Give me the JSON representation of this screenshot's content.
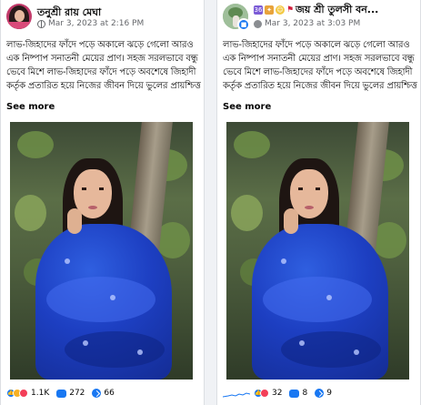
{
  "posts": [
    {
      "author": "তনুশ্রী রায় মেঘা",
      "time": "Mar 3, 2023 at 2:16 PM",
      "body": "লাভ-জিহাদের ফাঁদে পড়ে অকালে ঝড়ে গেলো আরও এক নিষ্পাপ সনাতনী মেয়ের প্রাণ। সহজ সরলভাবে বন্ধু ভেবে মিশে লাভ-জিহাদের ফাঁদে পড়ে অবশেষে জিহাদী কর্তৃক প্রতারিত হয়ে নিজের জীবন দিয়ে ভুলের প্রায়শ্চিত্ত করে গেলো...",
      "see_more": "See more",
      "reactions_count": "1.1K",
      "comments_count": "272",
      "shares_count": "66"
    },
    {
      "author": "জয় শ্রী তুলসী বন...",
      "emoji_badges": [
        "36",
        "✦",
        "☺",
        "⚑"
      ],
      "time": "Mar 3, 2023 at 3:03 PM",
      "body": "লাভ-জিহাদের ফাঁদে পড়ে অকালে ঝড়ে গেলো আরও এক নিষ্পাপ সনাতনী মেয়ের প্রাণ। সহজ সরলভাবে বন্ধু ভেবে মিশে লাভ-জিহাদের ফাঁদে পড়ে অবশেষে জিহাদী কর্তৃক প্রতারিত হয়ে নিজের জীবন দিয়ে ভুলের প্রায়শ্চিত্ত করে গেলো...",
      "see_more": "See more",
      "reactions_count": "32",
      "comments_count": "8",
      "shares_count": "9"
    }
  ],
  "colors": {
    "accent": "#1877f2",
    "secondary_text": "#65676b",
    "page_bg": "#f0f2f5"
  }
}
